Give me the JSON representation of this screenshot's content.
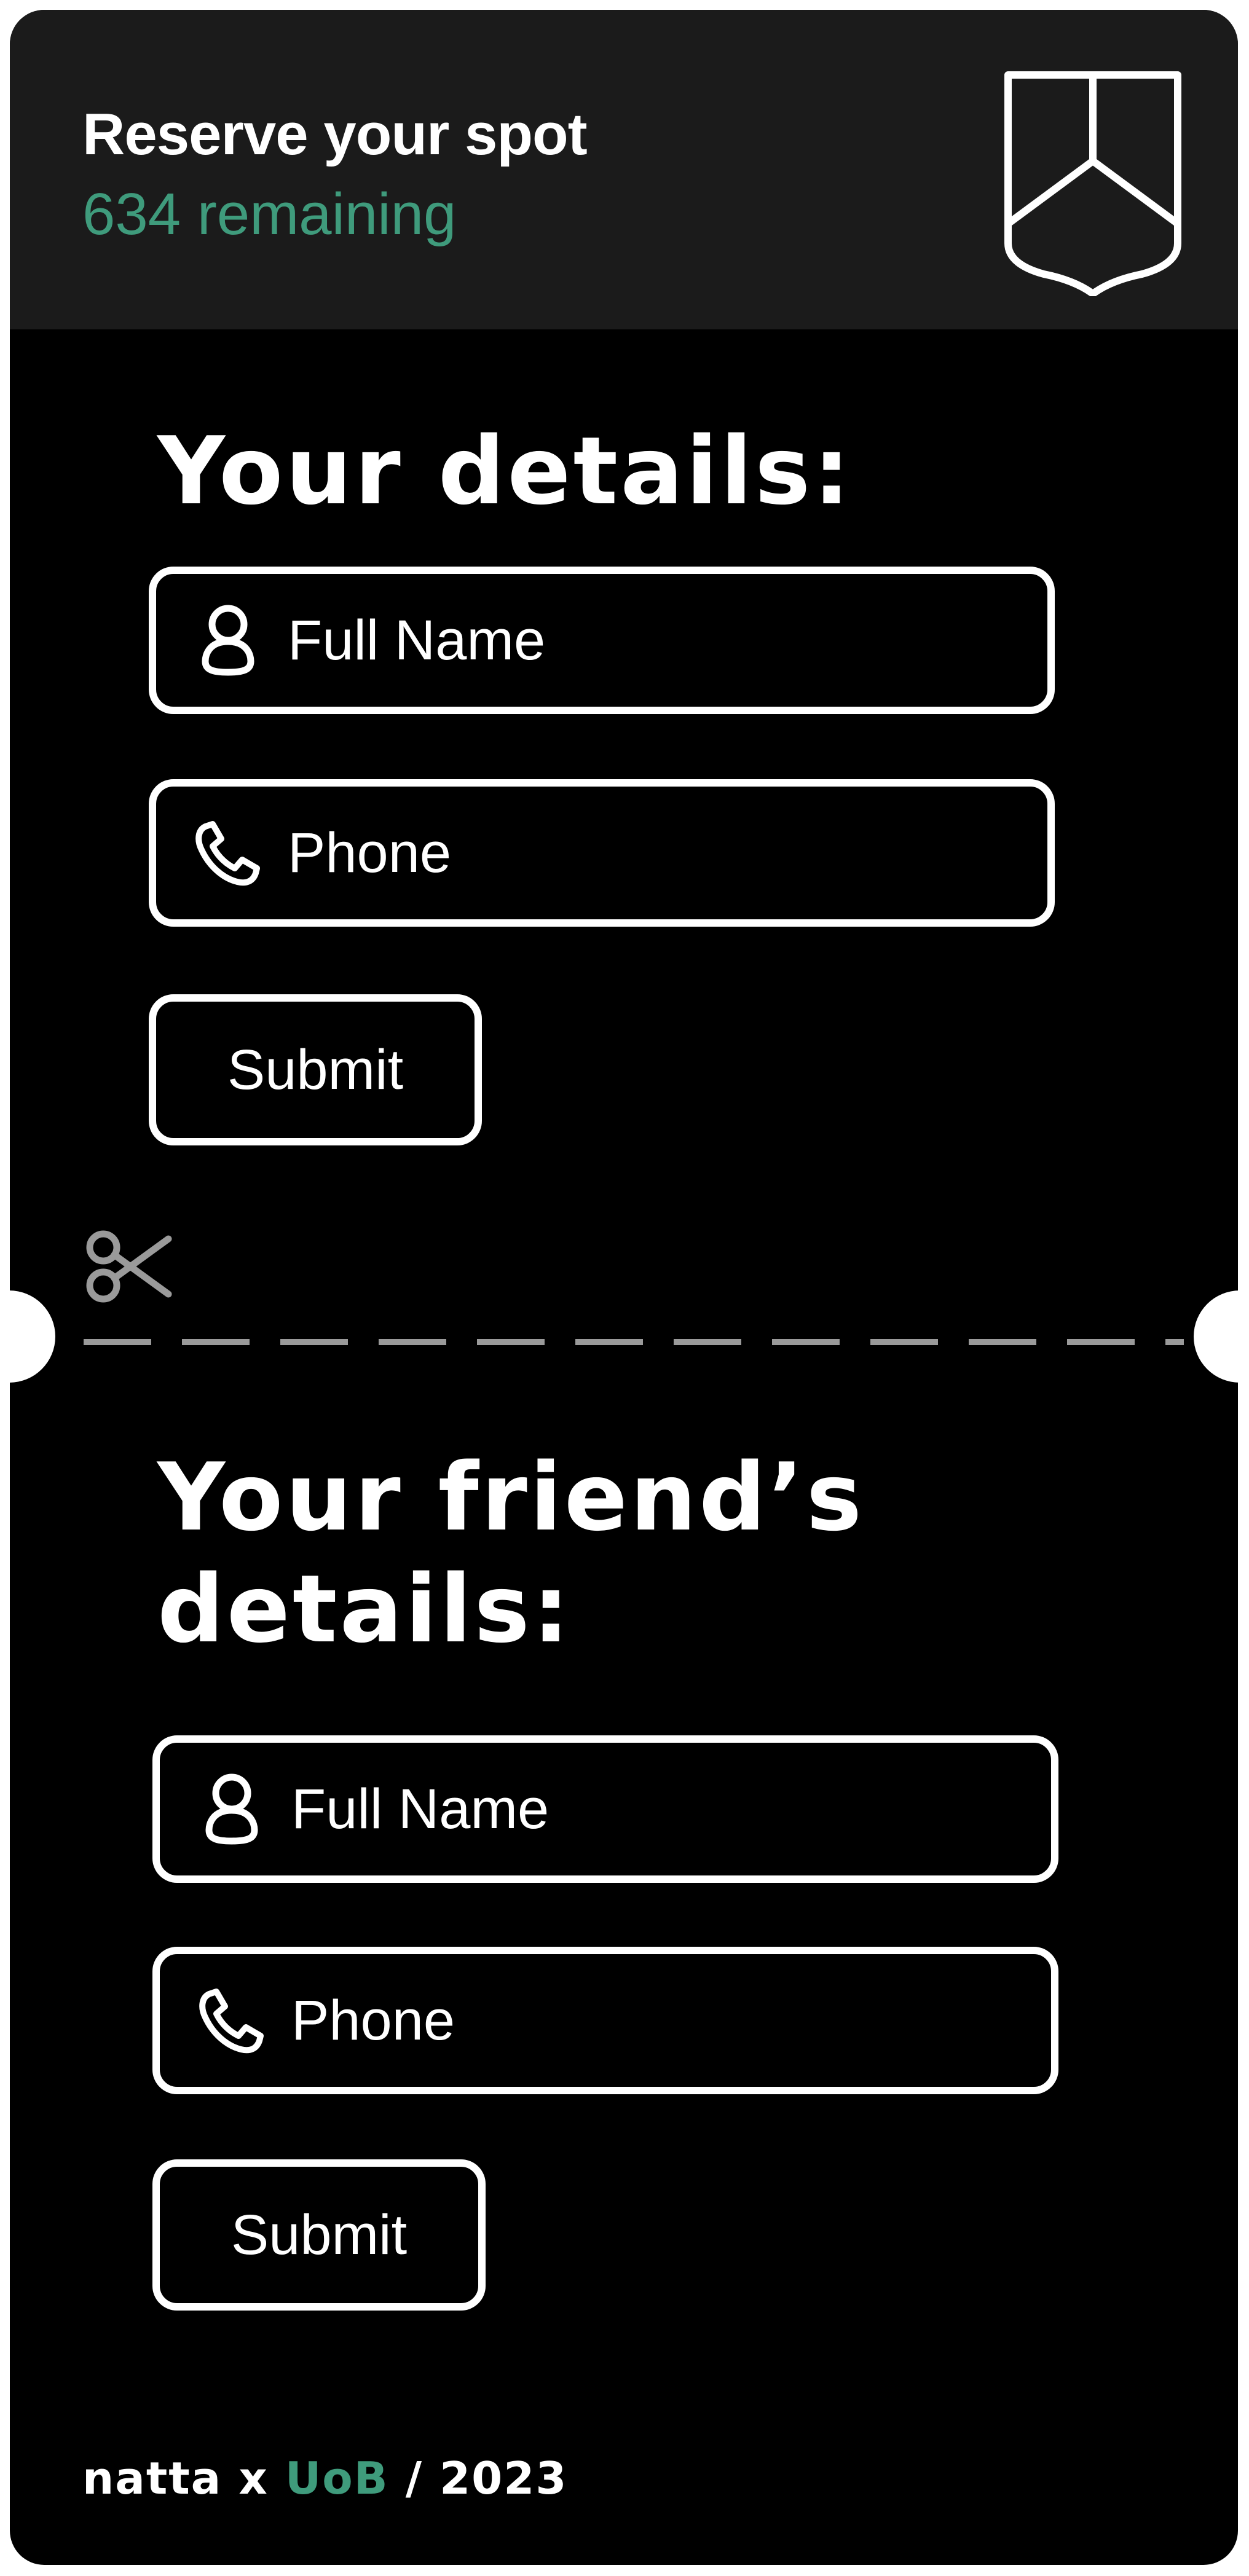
{
  "header": {
    "title": "Reserve your spot",
    "remaining": "634 remaining",
    "logo_icon": "shield-crest-icon"
  },
  "my_section": {
    "title": "Your details:",
    "name_field": {
      "placeholder": "Full Name",
      "icon": "person-icon"
    },
    "phone_field": {
      "placeholder": "Phone",
      "icon": "phone-icon"
    },
    "submit_label": "Submit"
  },
  "divider": {
    "icon": "scissors-icon"
  },
  "friend_section": {
    "title_line1": "Your friend’s",
    "title_line2": "details:",
    "name_field": {
      "placeholder": "Full Name",
      "icon": "person-icon"
    },
    "phone_field": {
      "placeholder": "Phone",
      "icon": "phone-icon"
    },
    "submit_label": "Submit"
  },
  "footer": {
    "brand": "natta x ",
    "partner": "UoB",
    "year_text": " / 2023"
  },
  "colors": {
    "background": "#000000",
    "header_bg": "#1b1b1b",
    "accent_green": "#3f9b7c",
    "text": "#ffffff",
    "divider_gray": "#9a9a9a"
  }
}
